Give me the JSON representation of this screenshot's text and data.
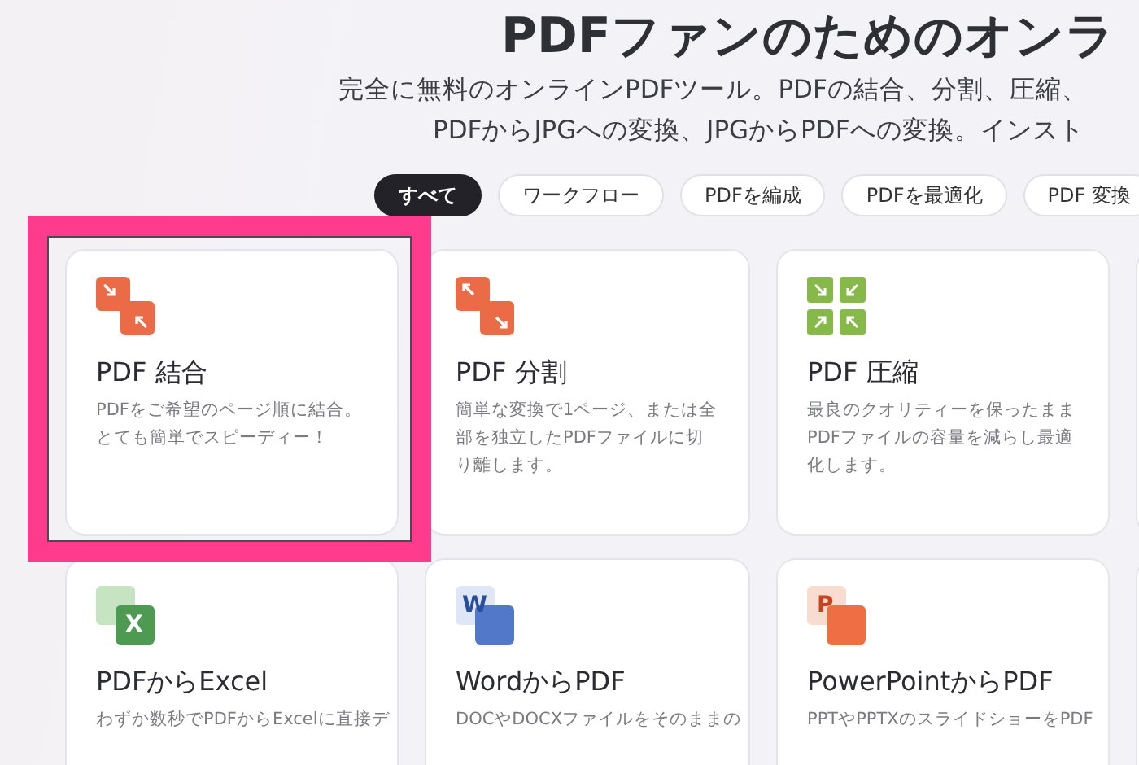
{
  "header": {
    "title": "PDFファンのためのオンラ",
    "subtitle_lines": [
      "完全に無料のオンラインPDFツール。PDFの結合、分割、圧縮、",
      "PDFからJPGへの変換、JPGからPDFへの変換。インスト"
    ]
  },
  "filters": [
    {
      "label": "すべて",
      "selected": true
    },
    {
      "label": "ワークフロー",
      "selected": false
    },
    {
      "label": "PDFを編成",
      "selected": false
    },
    {
      "label": "PDFを最適化",
      "selected": false
    },
    {
      "label": "PDF 変換",
      "selected": false
    }
  ],
  "tools": [
    {
      "kind": "merge",
      "title": "PDF 結合",
      "description": "PDFをご希望のページ順に結合。とても簡単でスピーディー！",
      "highlighted": true
    },
    {
      "kind": "split",
      "title": "PDF 分割",
      "description": "簡単な変換で1ページ、または全部を独立したPDFファイルに切り離します。",
      "highlighted": false
    },
    {
      "kind": "compress",
      "title": "PDF 圧縮",
      "description": "最良のクオリティーを保ったままPDFファイルの容量を減らし最適化します。",
      "highlighted": false
    },
    {
      "kind": "blank"
    },
    {
      "kind": "excel",
      "icon_letter": "X",
      "title": "PDFからExcel",
      "description": "わずか数秒でPDFからExcelに直接デ",
      "highlighted": false
    },
    {
      "kind": "word",
      "icon_letter": "W",
      "title": "WordからPDF",
      "description": "DOCやDOCXファイルをそのままの",
      "highlighted": false
    },
    {
      "kind": "powerpoint",
      "icon_letter": "P",
      "title": "PowerPointからPDF",
      "description": "PPTやPPTXのスライドショーをPDF",
      "highlighted": false
    },
    {
      "kind": "blank"
    }
  ]
}
